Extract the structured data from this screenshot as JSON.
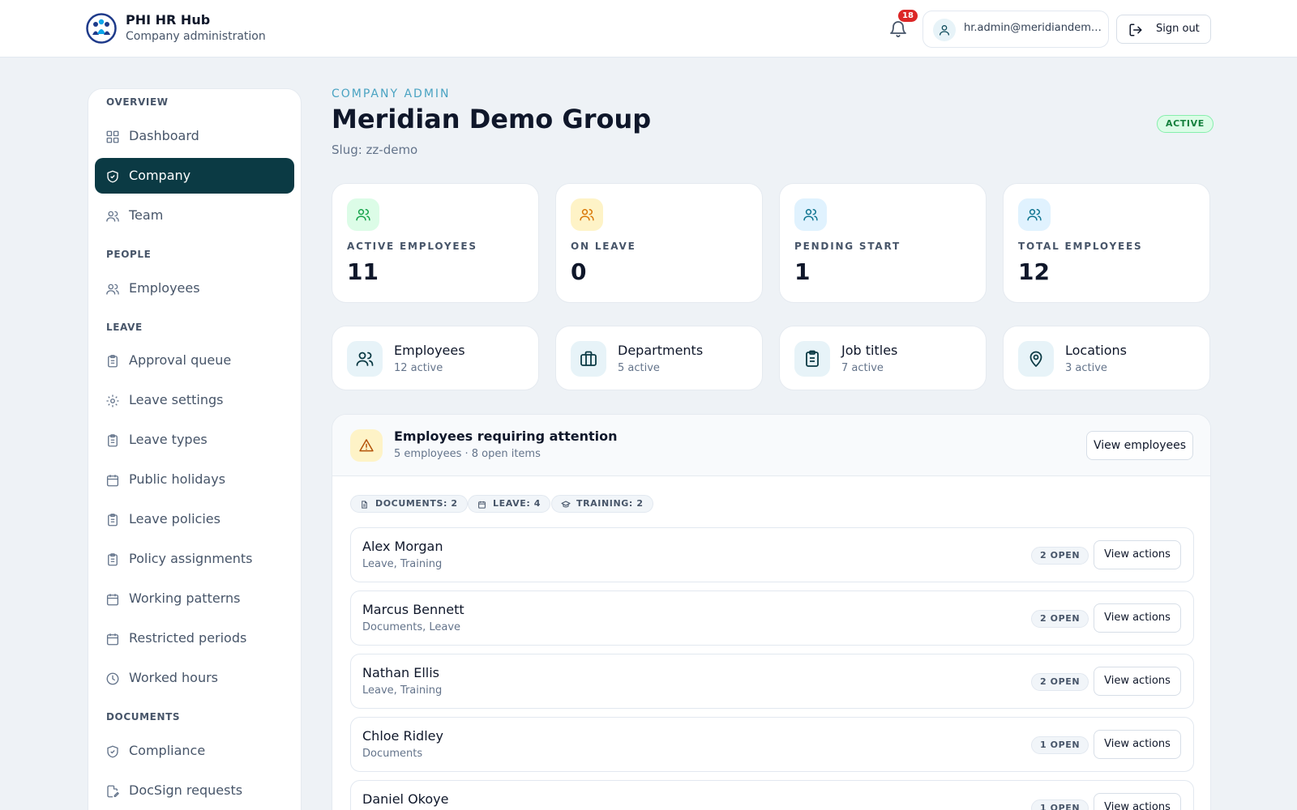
{
  "brand": {
    "title": "PHI HR Hub",
    "subtitle": "Company administration"
  },
  "header": {
    "notification_count": "18",
    "user_email": "hr.admin@meridiandemo.com",
    "sign_out_label": "Sign out"
  },
  "sidebar": {
    "sections": {
      "overview": "OVERVIEW",
      "people": "PEOPLE",
      "leave": "LEAVE",
      "documents": "DOCUMENTS"
    },
    "items": [
      {
        "label": "Dashboard",
        "icon": "grid-icon"
      },
      {
        "label": "Company",
        "icon": "shield-icon",
        "active": true
      },
      {
        "label": "Team",
        "icon": "users-icon"
      },
      {
        "label": "Employees",
        "icon": "users-icon"
      },
      {
        "label": "Approval queue",
        "icon": "clipboard-icon"
      },
      {
        "label": "Leave settings",
        "icon": "gear-icon"
      },
      {
        "label": "Leave types",
        "icon": "clipboard-icon"
      },
      {
        "label": "Public holidays",
        "icon": "calendar-icon"
      },
      {
        "label": "Leave policies",
        "icon": "clipboard-icon"
      },
      {
        "label": "Policy assignments",
        "icon": "clipboard-icon"
      },
      {
        "label": "Working patterns",
        "icon": "calendar-icon"
      },
      {
        "label": "Restricted periods",
        "icon": "calendar-icon"
      },
      {
        "label": "Worked hours",
        "icon": "clock-icon"
      },
      {
        "label": "Compliance",
        "icon": "shield-icon"
      },
      {
        "label": "DocSign requests",
        "icon": "file-signature-icon"
      }
    ]
  },
  "page": {
    "eyebrow": "COMPANY ADMIN",
    "title": "Meridian Demo Group",
    "slug": "Slug: zz-demo",
    "status": "ACTIVE"
  },
  "stats": [
    {
      "label": "ACTIVE EMPLOYEES",
      "value": "11",
      "icon": "users-icon",
      "color": "#16a34a",
      "bg": "#dcfce7"
    },
    {
      "label": "ON LEAVE",
      "value": "0",
      "icon": "users-icon",
      "color": "#d97706",
      "bg": "#fef3c7"
    },
    {
      "label": "PENDING START",
      "value": "1",
      "icon": "users-icon",
      "color": "#0e7490",
      "bg": "#e0f2fe"
    },
    {
      "label": "TOTAL EMPLOYEES",
      "value": "12",
      "icon": "users-icon",
      "color": "#0e7490",
      "bg": "#e0f2fe"
    }
  ],
  "quick_links": [
    {
      "title": "Employees",
      "subtitle": "12 active",
      "icon": "users-icon"
    },
    {
      "title": "Departments",
      "subtitle": "5 active",
      "icon": "briefcase-icon"
    },
    {
      "title": "Job titles",
      "subtitle": "7 active",
      "icon": "clipboard-icon"
    },
    {
      "title": "Locations",
      "subtitle": "3 active",
      "icon": "map-pin-icon"
    }
  ],
  "attention": {
    "title": "Employees requiring attention",
    "subtitle": "5 employees · 8 open items",
    "view_button": "View employees",
    "chips": [
      {
        "label": "DOCUMENTS: 2",
        "icon": "document-icon"
      },
      {
        "label": "LEAVE: 4",
        "icon": "calendar-icon"
      },
      {
        "label": "TRAINING: 2",
        "icon": "graduation-cap-icon"
      }
    ],
    "rows": [
      {
        "name": "Alex Morgan",
        "categories": "Leave, Training",
        "open": "2 OPEN",
        "action": "View actions"
      },
      {
        "name": "Marcus Bennett",
        "categories": "Documents, Leave",
        "open": "2 OPEN",
        "action": "View actions"
      },
      {
        "name": "Nathan Ellis",
        "categories": "Leave, Training",
        "open": "2 OPEN",
        "action": "View actions"
      },
      {
        "name": "Chloe Ridley",
        "categories": "Documents",
        "open": "1 OPEN",
        "action": "View actions"
      },
      {
        "name": "Daniel Okoye",
        "categories": "",
        "open": "1 OPEN",
        "action": "View actions"
      }
    ]
  },
  "colors": {
    "accent": "#0b3a44",
    "eyebrow": "#4aa3c2",
    "background": "#eef2f6"
  }
}
